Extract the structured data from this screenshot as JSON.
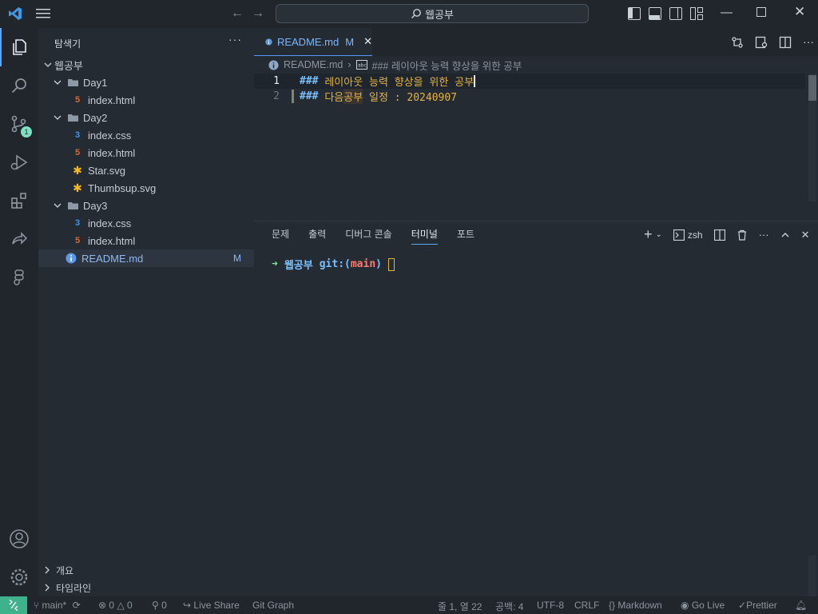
{
  "titlebar": {
    "search_text": "웹공부",
    "icons": [
      "vscode-logo-icon",
      "menu-icon",
      "back-arrow-icon",
      "forward-arrow-icon",
      "search-icon",
      "toggle-primary-sidebar-icon",
      "toggle-panel-icon",
      "toggle-secondary-sidebar-icon",
      "customize-layout-icon",
      "minimize-icon",
      "maximize-icon",
      "close-icon"
    ]
  },
  "activitybar": {
    "scm_badge": "1",
    "items": [
      "explorer-icon",
      "search-icon",
      "source-control-icon",
      "run-debug-icon",
      "extensions-icon",
      "live-share-icon",
      "figma-icon",
      "account-icon",
      "settings-icon"
    ]
  },
  "sidebar": {
    "title": "탐색기",
    "more": "···",
    "root": "웹공부",
    "tree": [
      {
        "label": "Day1",
        "kind": "folder"
      },
      {
        "label": "index.html",
        "kind": "html"
      },
      {
        "label": "Day2",
        "kind": "folder"
      },
      {
        "label": "index.css",
        "kind": "css"
      },
      {
        "label": "index.html",
        "kind": "html"
      },
      {
        "label": "Star.svg",
        "kind": "svg"
      },
      {
        "label": "Thumbsup.svg",
        "kind": "svg"
      },
      {
        "label": "Day3",
        "kind": "folder"
      },
      {
        "label": "index.css",
        "kind": "css"
      },
      {
        "label": "index.html",
        "kind": "html"
      },
      {
        "label": "README.md",
        "kind": "info",
        "badge": "M"
      }
    ],
    "outline": "개요",
    "timeline": "타임라인"
  },
  "editor": {
    "tab_label": "README.md",
    "tab_modified": "M",
    "tab_close": "✕",
    "breadcrumb_file": "README.md",
    "breadcrumb_sep": "›",
    "breadcrumb_symbol": "### 레이아웃 능력 향상을 위한 공부",
    "lines": [
      {
        "num": "1",
        "hash": "###",
        "text": "레이아웃 능력 향상을 위한 공부"
      },
      {
        "num": "2",
        "hash": "###",
        "text_a": "다음 ",
        "text_hl": "공부",
        "text_b": " 일정 : 20240907"
      }
    ]
  },
  "panel": {
    "tabs": [
      "문제",
      "출력",
      "디버그 콘솔",
      "터미널",
      "포트"
    ],
    "active_tab": "터미널",
    "shell": "zsh",
    "terminal": {
      "arrow": "➜",
      "dir": "웹공부",
      "git": "git:(",
      "branch": "main",
      "git_close": ")"
    }
  },
  "statusbar": {
    "branch": "main*",
    "errors": "0",
    "warnings": "0",
    "ports": "0",
    "live_share": "Live Share",
    "git_graph": "Git Graph",
    "position": "줄 1, 열 22",
    "spaces": "공백: 4",
    "encoding": "UTF-8",
    "eol": "CRLF",
    "language": "Markdown",
    "go_live": "Go Live",
    "prettier": "Prettier"
  },
  "colors": {
    "accent": "#58a6ff",
    "heading_hash": "#79c0ff",
    "heading_text": "#e3b341",
    "remote": "#3fb28c",
    "scm_badge": "#7ee0c0"
  }
}
